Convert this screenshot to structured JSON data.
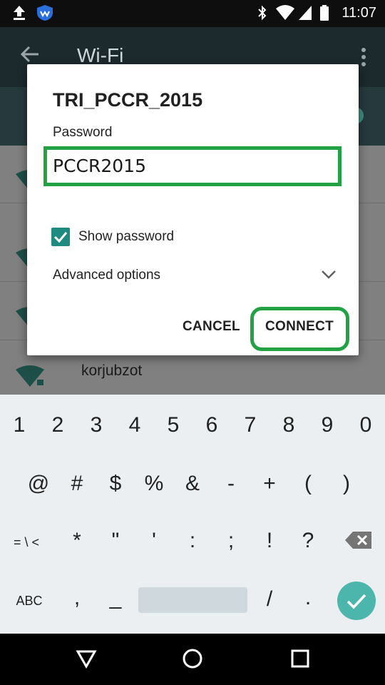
{
  "status_bar": {
    "time": "11:07"
  },
  "app_bar": {
    "title": "Wi-Fi"
  },
  "networks": [
    {
      "name": ""
    },
    {
      "name": ""
    },
    {
      "name": ""
    },
    {
      "name": "korjubzot"
    }
  ],
  "dialog": {
    "title": "TRI_PCCR_2015",
    "password_label": "Password",
    "password_value": "PCCR2015",
    "show_password_label": "Show password",
    "show_password_checked": true,
    "advanced_label": "Advanced options",
    "cancel_label": "CANCEL",
    "connect_label": "CONNECT",
    "highlight_color": "#23a244"
  },
  "keyboard": {
    "row1": [
      "1",
      "2",
      "3",
      "4",
      "5",
      "6",
      "7",
      "8",
      "9",
      "0"
    ],
    "row2": [
      "@",
      "#",
      "$",
      "%",
      "&",
      "-",
      "+",
      "(",
      ")"
    ],
    "row3_left": "= \\ <",
    "row3": [
      "*",
      "\"",
      "'",
      ":",
      ";",
      "!",
      "?"
    ],
    "row4_left": "ABC",
    "row4_a": ",",
    "row4_b": "_",
    "row4_c": "/",
    "row4_d": "."
  },
  "icons": {
    "status": [
      "upload-icon",
      "shield-icon",
      "bluetooth-icon",
      "wifi-icon",
      "signal-icon",
      "battery-icon"
    ],
    "nav": [
      "back-triangle-icon",
      "home-circle-icon",
      "recents-square-icon"
    ],
    "accent": "#1f8a80"
  }
}
